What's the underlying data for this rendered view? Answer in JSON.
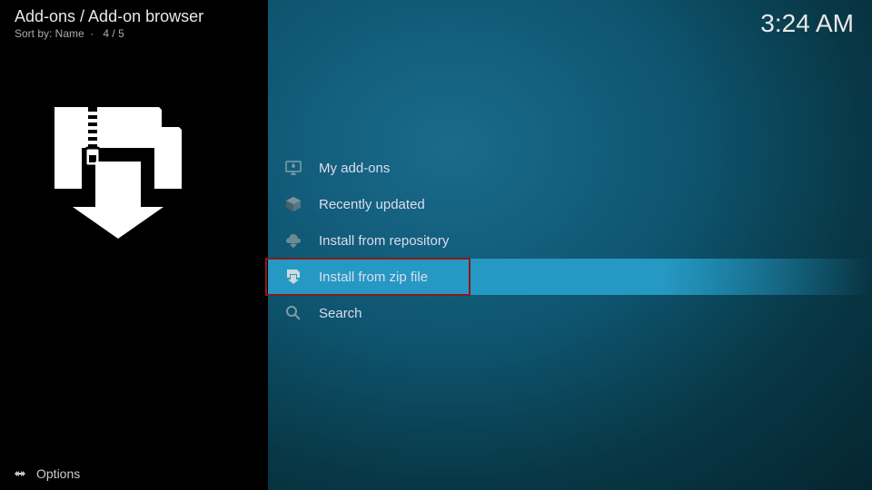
{
  "header": {
    "breadcrumb": "Add-ons / Add-on browser",
    "sort_label": "Sort by: Name",
    "position": "4 / 5"
  },
  "clock": "3:24 AM",
  "menu": {
    "items": [
      {
        "label": "My add-ons",
        "icon": "monitor-icon"
      },
      {
        "label": "Recently updated",
        "icon": "box-icon"
      },
      {
        "label": "Install from repository",
        "icon": "cloud-download-icon"
      },
      {
        "label": "Install from zip file",
        "icon": "zip-file-icon"
      },
      {
        "label": "Search",
        "icon": "search-icon"
      }
    ],
    "selected_index": 3
  },
  "footer": {
    "options_label": "Options"
  }
}
